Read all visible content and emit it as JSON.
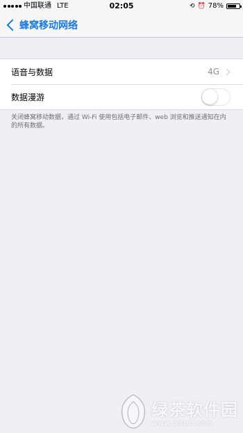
{
  "status_bar": {
    "carrier": "中国联通",
    "network": "LTE",
    "time": "02:05",
    "battery_percent": "78%",
    "battery_level": 0.78,
    "icons": [
      "orientation-lock-icon",
      "alarm-icon"
    ]
  },
  "nav": {
    "back_label": "蜂窝移动网络",
    "back_icon": "chevron-left-icon",
    "tint_color": "#1779e7"
  },
  "settings": {
    "voice_data": {
      "label": "语音与数据",
      "value": "4G"
    },
    "data_roaming": {
      "label": "数据漫游",
      "enabled": false
    }
  },
  "footer_note": "关闭蜂窝移动数据，通过 Wi-Fi 使用包括电子邮件、web 浏览和推送通知在内的所有数据。",
  "watermark": {
    "brand": "绿茶软件园",
    "url": "www.33LC.com"
  }
}
